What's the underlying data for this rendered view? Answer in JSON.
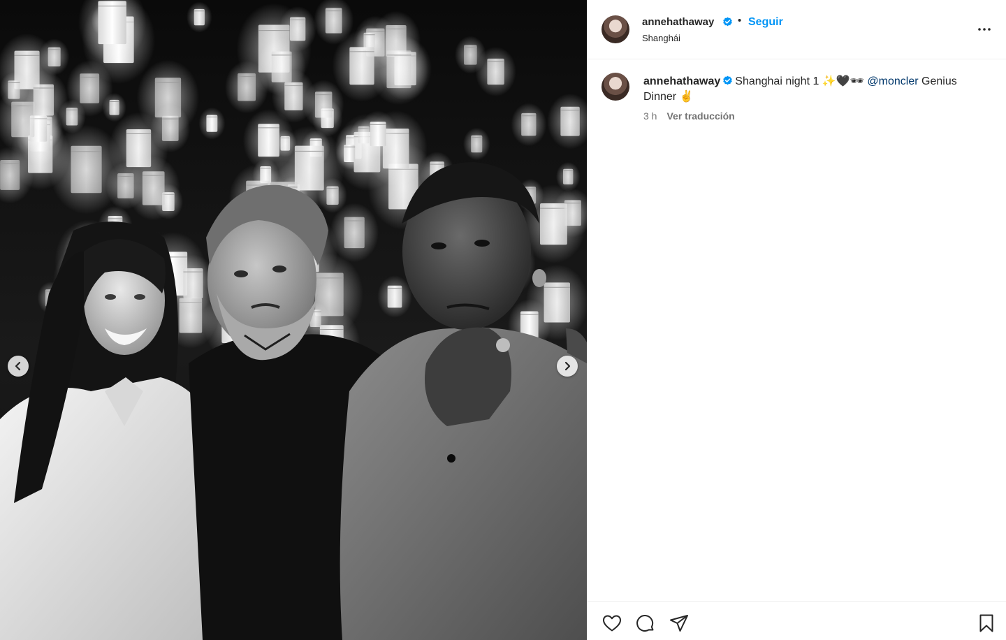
{
  "post": {
    "username": "annehathaway",
    "follow_label": "Seguir",
    "separator": "•",
    "location": "Shanghái"
  },
  "caption": {
    "username": "annehathaway",
    "text_before_mention": "Shanghai night 1 ✨🖤🕶",
    "mention": "@moncler",
    "text_after_mention": "Genius Dinner ✌️",
    "time_ago": "3 h",
    "translate_label": "Ver traducción"
  },
  "icons": {
    "verified": "verified-badge-icon",
    "more": "more-options-icon",
    "prev": "chevron-left-icon",
    "next": "chevron-right-icon",
    "like": "heart-icon",
    "comment": "comment-icon",
    "share": "paper-plane-icon",
    "save": "bookmark-icon"
  },
  "colors": {
    "accent": "#0095f6",
    "mention": "#00376b",
    "text": "#262626",
    "muted": "#737373",
    "border": "#efefef"
  }
}
